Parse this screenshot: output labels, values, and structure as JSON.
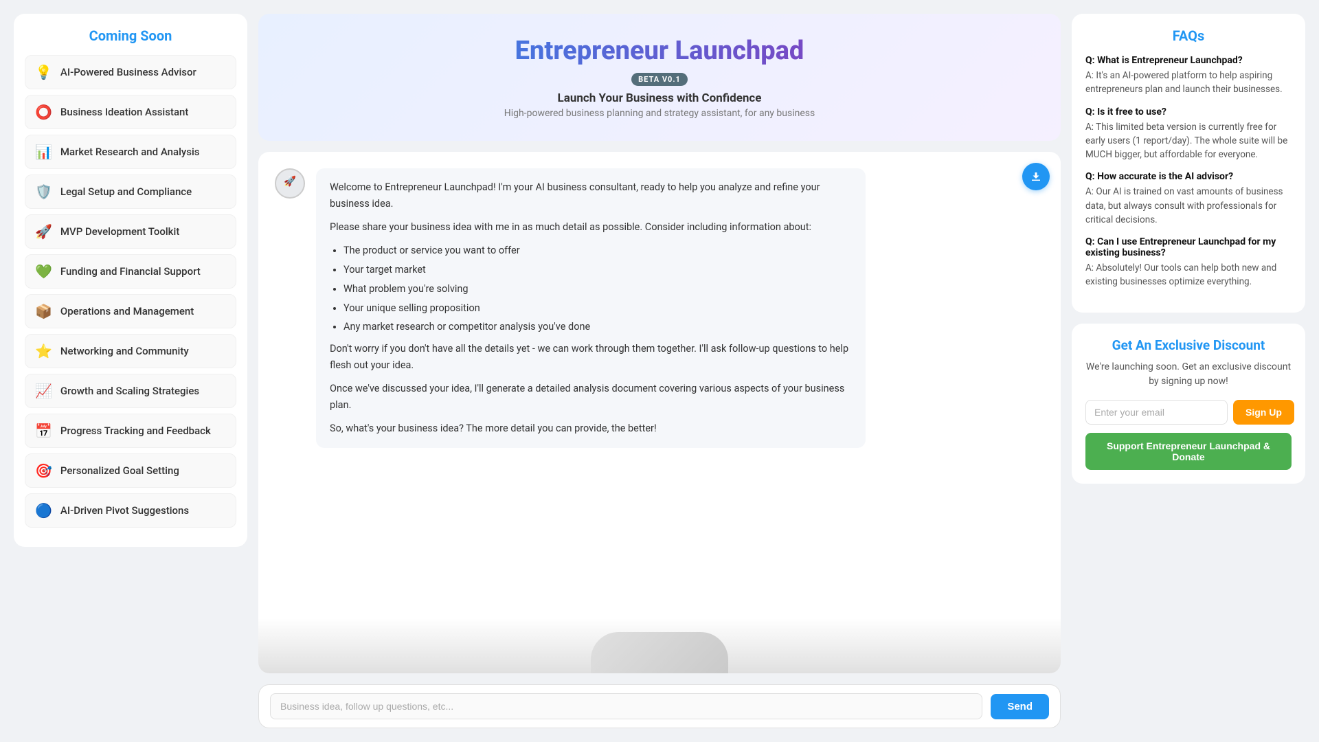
{
  "sidebar": {
    "title": "Coming Soon",
    "items": [
      {
        "id": "ai-powered-advisor",
        "icon": "💡",
        "label": "AI-Powered Business Advisor"
      },
      {
        "id": "business-ideation",
        "icon": "⭕",
        "label": "Business Ideation Assistant"
      },
      {
        "id": "market-research",
        "icon": "📊",
        "label": "Market Research and Analysis"
      },
      {
        "id": "legal-setup",
        "icon": "🛡️",
        "label": "Legal Setup and Compliance"
      },
      {
        "id": "mvp-toolkit",
        "icon": "🚀",
        "label": "MVP Development Toolkit"
      },
      {
        "id": "funding",
        "icon": "💚",
        "label": "Funding and Financial Support"
      },
      {
        "id": "operations",
        "icon": "📦",
        "label": "Operations and Management"
      },
      {
        "id": "networking",
        "icon": "⭐",
        "label": "Networking and Community"
      },
      {
        "id": "growth",
        "icon": "📈",
        "label": "Growth and Scaling Strategies"
      },
      {
        "id": "progress",
        "icon": "📅",
        "label": "Progress Tracking and Feedback"
      },
      {
        "id": "goal-setting",
        "icon": "🎯",
        "label": "Personalized Goal Setting"
      },
      {
        "id": "pivot",
        "icon": "🔵",
        "label": "AI-Driven Pivot Suggestions"
      }
    ]
  },
  "header": {
    "title": "Entrepreneur Launchpad",
    "beta": "BETA V0.1",
    "subtitle": "Launch Your Business with Confidence",
    "description": "High-powered business planning and strategy assistant, for any business"
  },
  "chat": {
    "download_label": "⬇",
    "welcome_p1": "Welcome to Entrepreneur Launchpad! I'm your AI business consultant, ready to help you analyze and refine your business idea.",
    "welcome_p2": "Please share your business idea with me in as much detail as possible. Consider including information about:",
    "bullet1": "The product or service you want to offer",
    "bullet2": "Your target market",
    "bullet3": "What problem you're solving",
    "bullet4": "Your unique selling proposition",
    "bullet5": "Any market research or competitor analysis you've done",
    "welcome_p3": "Don't worry if you don't have all the details yet - we can work through them together. I'll ask follow-up questions to help flesh out your idea.",
    "welcome_p4": "Once we've discussed your idea, I'll generate a detailed analysis document covering various aspects of your business plan.",
    "welcome_p5": "So, what's your business idea? The more detail you can provide, the better!",
    "input_placeholder": "Business idea, follow up questions, etc...",
    "send_label": "Send"
  },
  "faqs": {
    "title": "FAQs",
    "items": [
      {
        "question": "Q: What is Entrepreneur Launchpad?",
        "answer": "A: It's an AI-powered platform to help aspiring entrepreneurs plan and launch their businesses."
      },
      {
        "question": "Q: Is it free to use?",
        "answer": "A: This limited beta version is currently free for early users (1 report/day). The whole suite will be MUCH bigger, but affordable for everyone."
      },
      {
        "question": "Q: How accurate is the AI advisor?",
        "answer": "A: Our AI is trained on vast amounts of business data, but always consult with professionals for critical decisions."
      },
      {
        "question": "Q: Can I use Entrepreneur Launchpad for my existing business?",
        "answer": "A: Absolutely! Our tools can help both new and existing businesses optimize everything."
      }
    ]
  },
  "discount": {
    "title": "Get An Exclusive Discount",
    "description": "We're launching soon. Get an exclusive discount by signing up now!",
    "email_placeholder": "Enter your email",
    "signup_label": "Sign Up",
    "support_label": "Support Entrepreneur Launchpad & Donate"
  }
}
